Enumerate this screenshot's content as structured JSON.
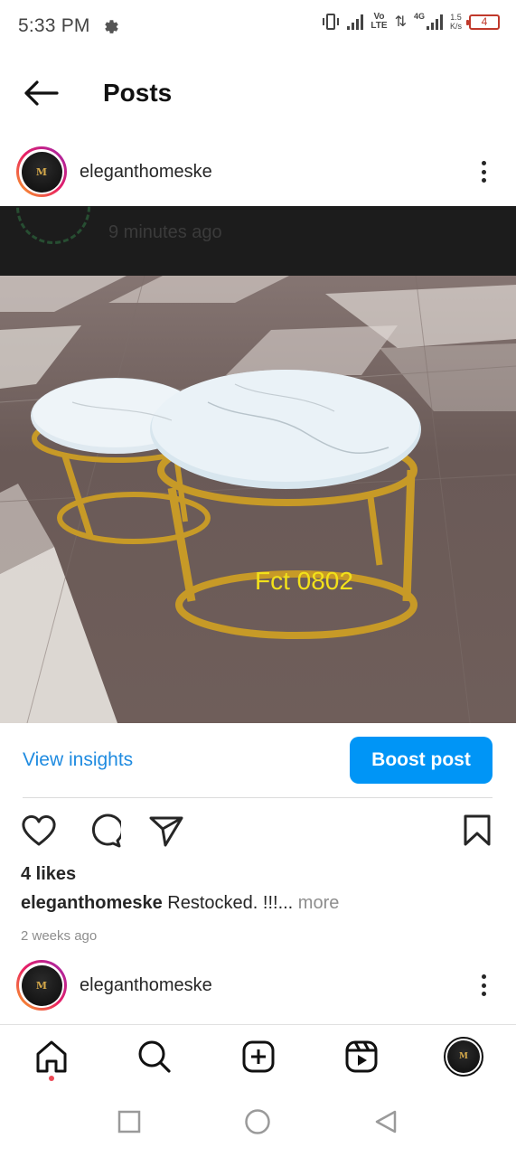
{
  "status_bar": {
    "time": "5:33 PM",
    "network_vo": "Vo",
    "network_lte": "LTE",
    "network_4g": "4G",
    "speed_value": "1.5",
    "speed_unit": "K/s",
    "battery": "4",
    "icons": [
      "gear-icon",
      "vibrate-icon",
      "signal-icon",
      "data-arrows-icon",
      "battery-icon"
    ]
  },
  "header": {
    "title": "Posts",
    "back_icon": "arrow-left-icon"
  },
  "post": {
    "username": "eleganthomeske",
    "avatar_monogram": "M",
    "story_overlay_text": "9 minutes ago",
    "image_code": "Fct 0802",
    "view_insights": "View insights",
    "boost_button": "Boost post",
    "likes": "4 likes",
    "caption_user": "eleganthomeske",
    "caption_text": " Restocked. !!!...",
    "caption_more": " more",
    "timestamp": "2 weeks ago",
    "action_icons": [
      "heart-icon",
      "comment-icon",
      "send-icon",
      "bookmark-icon"
    ]
  },
  "next_post": {
    "username": "eleganthomeske"
  },
  "bottom_nav": {
    "items": [
      "home-icon",
      "search-icon",
      "add-icon",
      "reels-icon",
      "profile-avatar"
    ]
  },
  "system_nav": {
    "items": [
      "recents-icon",
      "home-circle-icon",
      "back-triangle-icon"
    ]
  },
  "colors": {
    "accent_blue": "#0095f6",
    "link_blue": "#1f8be0",
    "notification_red": "#ed4956",
    "battery_red": "#c0392b",
    "price_tag_yellow": "#f2e11a"
  }
}
